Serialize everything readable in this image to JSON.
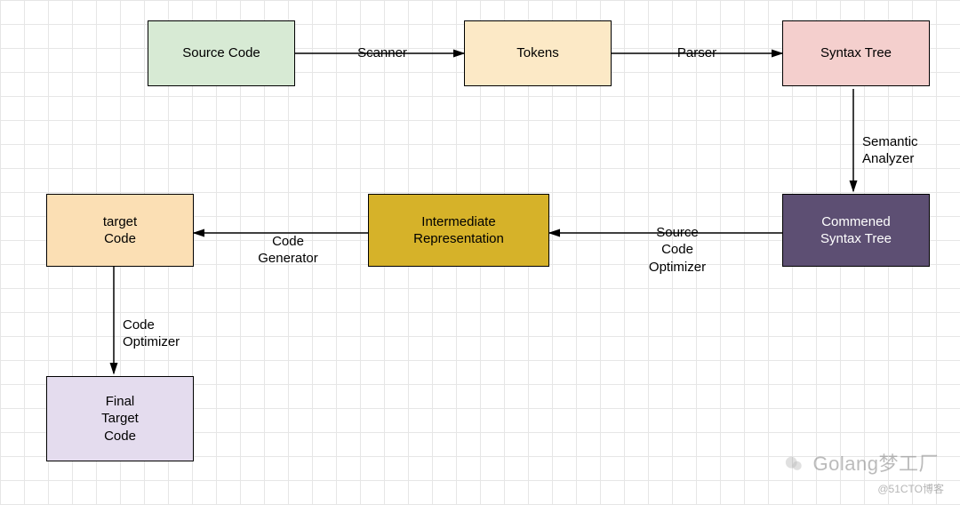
{
  "nodes": {
    "source_code": {
      "label": "Source Code",
      "bg": "#d7ead4",
      "fg": "#000000"
    },
    "tokens": {
      "label": "Tokens",
      "bg": "#fce9c6",
      "fg": "#000000"
    },
    "syntax_tree": {
      "label": "Syntax Tree",
      "bg": "#f4cfcd",
      "fg": "#000000"
    },
    "commened_tree": {
      "label": "Commened\nSyntax Tree",
      "bg": "#5d4f73",
      "fg": "#ffffff"
    },
    "intermediate": {
      "label": "Intermediate\nRepresentation",
      "bg": "#d6b229",
      "fg": "#000000"
    },
    "target_code": {
      "label": "target\nCode",
      "bg": "#fbdfb4",
      "fg": "#000000"
    },
    "final_target": {
      "label": "Final\nTarget\nCode",
      "bg": "#e4dcee",
      "fg": "#000000"
    }
  },
  "edges": {
    "scanner": "Scanner",
    "parser": "Parser",
    "semantic": "Semantic\nAnalyzer",
    "src_optimizer": "Source\nCode\nOptimizer",
    "code_generator": "Code\nGenerator",
    "code_optimizer": "Code\nOptimizer"
  },
  "watermark": "Golang梦工厂",
  "attribution": "@51CTO博客"
}
